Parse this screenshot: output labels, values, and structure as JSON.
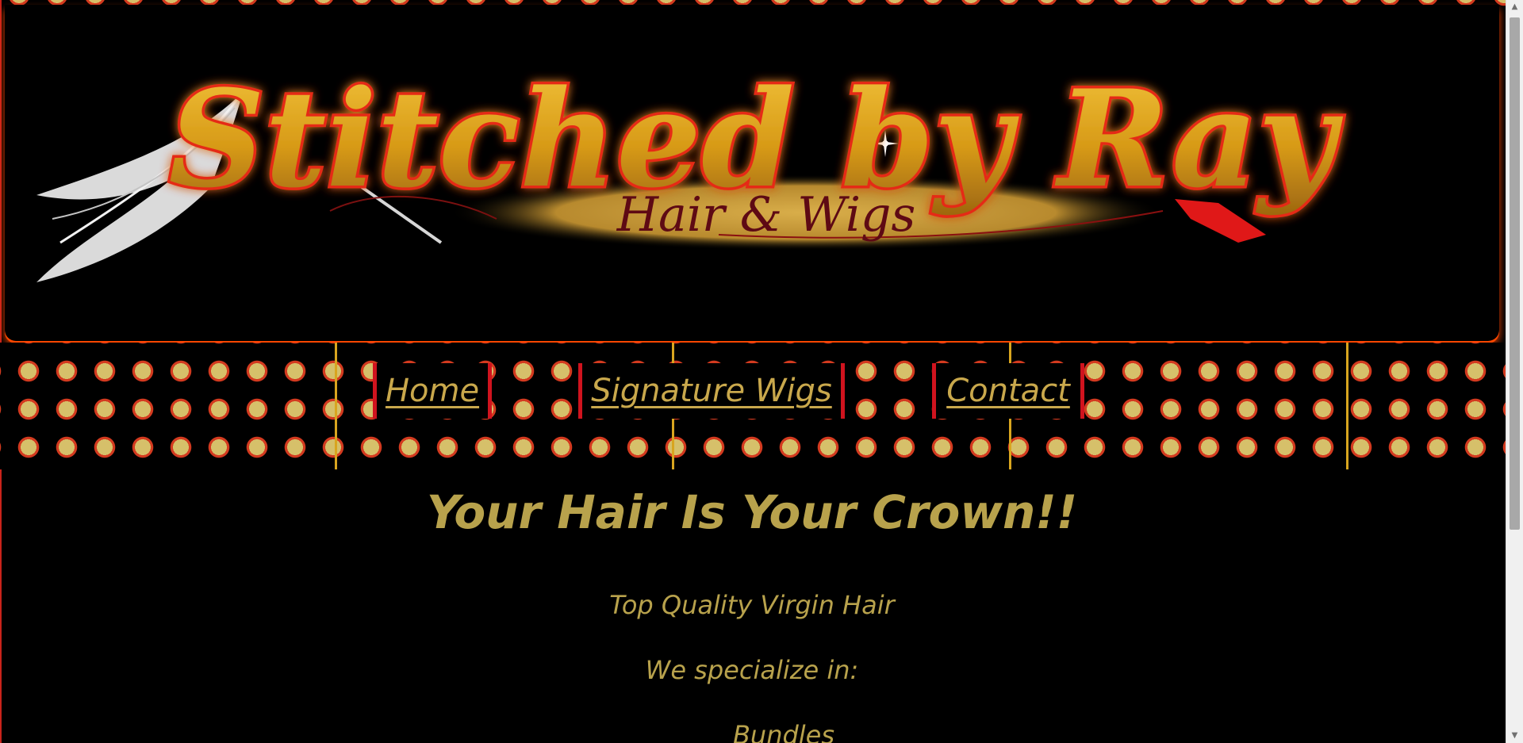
{
  "site": {
    "logo": {
      "title": "Stitched by Ray",
      "subtitle": "Hair & Wigs"
    }
  },
  "nav": {
    "items": [
      {
        "label": "Home"
      },
      {
        "label": "Signature Wigs"
      },
      {
        "label": "Contact"
      }
    ]
  },
  "main": {
    "headline": "Your Hair Is Your Crown!!",
    "paragraphs": [
      "Top Quality Virgin Hair",
      "We specialize in:",
      "Bundles"
    ]
  },
  "colors": {
    "gold_text": "#b8a24c",
    "nav_border": "#d0131e",
    "glow": "#ff4b00",
    "dot_fill": "#d6c06a"
  },
  "icons": {
    "scroll_up": "triangle-up",
    "scroll_down": "triangle-down"
  }
}
